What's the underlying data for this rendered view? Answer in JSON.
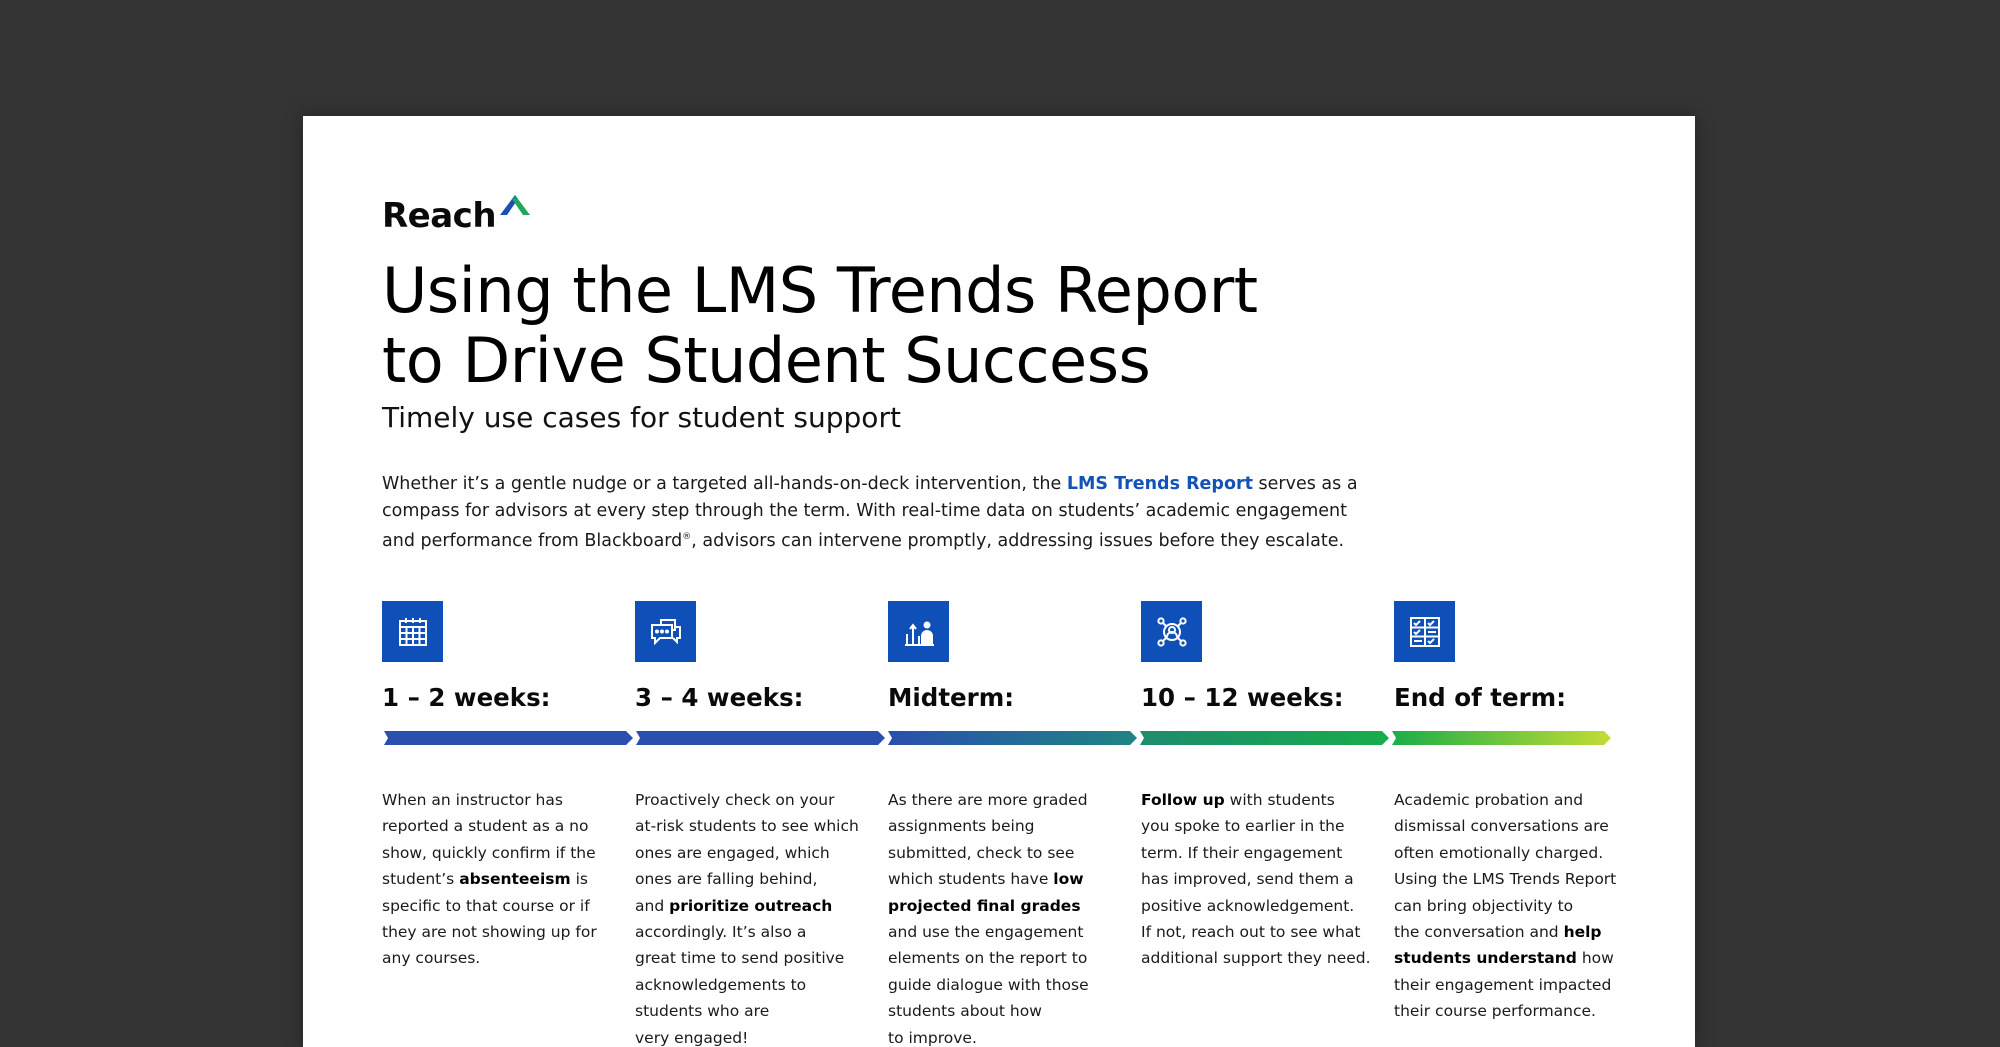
{
  "brand": {
    "name": "Reach"
  },
  "title_lines": [
    "Using the LMS Trends Report",
    "to Drive Student Success"
  ],
  "subtitle": "Timely use cases for student support",
  "intro": {
    "line1_pre": "Whether it’s a gentle nudge or a targeted all-hands-on-deck intervention, the ",
    "line1_link": "LMS Trends Report",
    "line1_post": " serves as a",
    "line2": "compass for advisors at every step through the term. With real-time data on students’ academic engagement",
    "line3_pre": "and performance from Blackboard",
    "line3_sup": "®",
    "line3_post": ", advisors can intervene promptly, addressing issues before they escalate."
  },
  "colors": {
    "icon_bg": "#0f4fb8",
    "link": "#1552b6",
    "timeline": [
      "#2a4fae",
      "#2a4fae",
      "#216a93",
      "#1ba151",
      "#bcd834"
    ]
  },
  "columns": [
    {
      "label": "1 – 2 weeks:",
      "icon": "calendar-icon",
      "lines": [
        [
          "When an instructor has"
        ],
        [
          "reported a student as a no"
        ],
        [
          "show, quickly confirm if the"
        ],
        [
          "student’s ",
          "absenteeism",
          " is"
        ],
        [
          "specific to that course or if"
        ],
        [
          "they are not showing up for"
        ],
        [
          "any courses."
        ]
      ]
    },
    {
      "label": "3 – 4 weeks:",
      "icon": "chat-bubbles-icon",
      "lines": [
        [
          "Proactively check on your"
        ],
        [
          "at-risk students to see which"
        ],
        [
          "ones are engaged, which"
        ],
        [
          "ones are falling behind,"
        ],
        [
          "and ",
          "prioritize outreach"
        ],
        [
          "accordingly. It’s also a"
        ],
        [
          "great time to send positive"
        ],
        [
          "acknowledgements to"
        ],
        [
          "students who are"
        ],
        [
          "very engaged!"
        ]
      ]
    },
    {
      "label": "Midterm:",
      "icon": "grades-chart-icon",
      "lines": [
        [
          "As there are more graded"
        ],
        [
          "assignments being"
        ],
        [
          "submitted, check to see"
        ],
        [
          "which students have ",
          "low"
        ],
        [
          "",
          "projected final grades"
        ],
        [
          "and use the engagement"
        ],
        [
          "elements on the report to"
        ],
        [
          "guide dialogue with those"
        ],
        [
          "students about how"
        ],
        [
          "to improve."
        ]
      ]
    },
    {
      "label": "10 – 12 weeks:",
      "icon": "network-people-icon",
      "lines": [
        [
          "",
          "Follow up",
          " with students"
        ],
        [
          "you spoke to earlier in the"
        ],
        [
          "term. If their engagement"
        ],
        [
          "has improved, send them a"
        ],
        [
          "positive acknowledgement."
        ],
        [
          "If not, reach out to see what"
        ],
        [
          "additional support they need."
        ]
      ]
    },
    {
      "label": "End of term:",
      "icon": "checklist-grid-icon",
      "lines": [
        [
          "Academic probation and"
        ],
        [
          "dismissal conversations are"
        ],
        [
          "often emotionally charged."
        ],
        [
          "Using the LMS Trends Report"
        ],
        [
          "can bring objectivity to"
        ],
        [
          "the conversation and ",
          "help"
        ],
        [
          "",
          "students understand",
          " how"
        ],
        [
          "their engagement impacted"
        ],
        [
          "their course performance."
        ]
      ]
    }
  ]
}
